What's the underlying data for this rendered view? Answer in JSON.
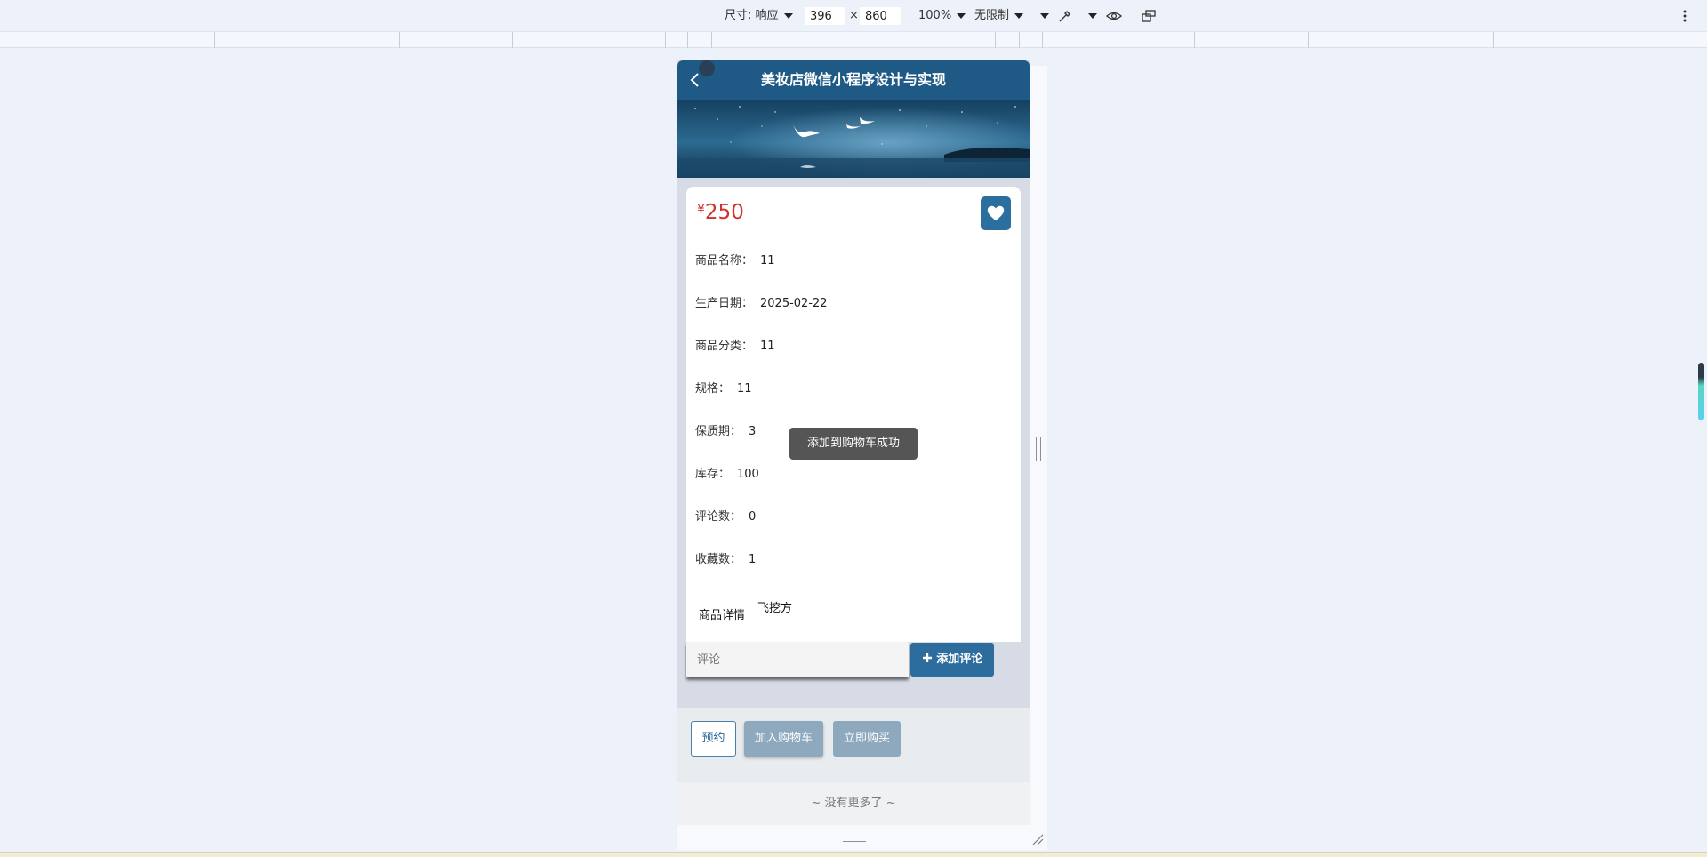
{
  "devtools": {
    "dimensions_label": "尺寸: 响应",
    "width_value": "396",
    "times_sign": "×",
    "height_value": "860",
    "zoom": "100%",
    "throttle": "无限制"
  },
  "header": {
    "title": "美妆店微信小程序设计与实现"
  },
  "product": {
    "currency": "¥",
    "price": "250",
    "fields": [
      {
        "label": "商品名称：",
        "value": "11"
      },
      {
        "label": "生产日期：",
        "value": "2025-02-22"
      },
      {
        "label": "商品分类：",
        "value": "11"
      },
      {
        "label": "规格：",
        "value": "11"
      },
      {
        "label": "保质期：",
        "value": "3"
      },
      {
        "label": "库存：",
        "value": "100"
      },
      {
        "label": "评论数：",
        "value": "0"
      },
      {
        "label": "收藏数：",
        "value": "1"
      }
    ],
    "detail_label": "商品详情",
    "detail_value": "飞挖方"
  },
  "comment": {
    "placeholder": "评论",
    "add_button": "添加评论"
  },
  "actions": {
    "reserve": "预约",
    "add_to_cart": "加入购物车",
    "buy_now": "立即购买"
  },
  "footer": {
    "no_more": "~ 没有更多了 ~"
  },
  "toast": {
    "message": "添加到购物车成功"
  },
  "colors": {
    "header": "#1f5a87",
    "price": "#d0312d",
    "primary_button": "#2c6d9e",
    "muted_button": "#8ea8bd"
  },
  "icons": [
    "back-arrow-icon",
    "heart-icon",
    "plus-icon",
    "eyedropper-icon",
    "eye-icon",
    "rotate-icon",
    "more-vert-icon"
  ]
}
